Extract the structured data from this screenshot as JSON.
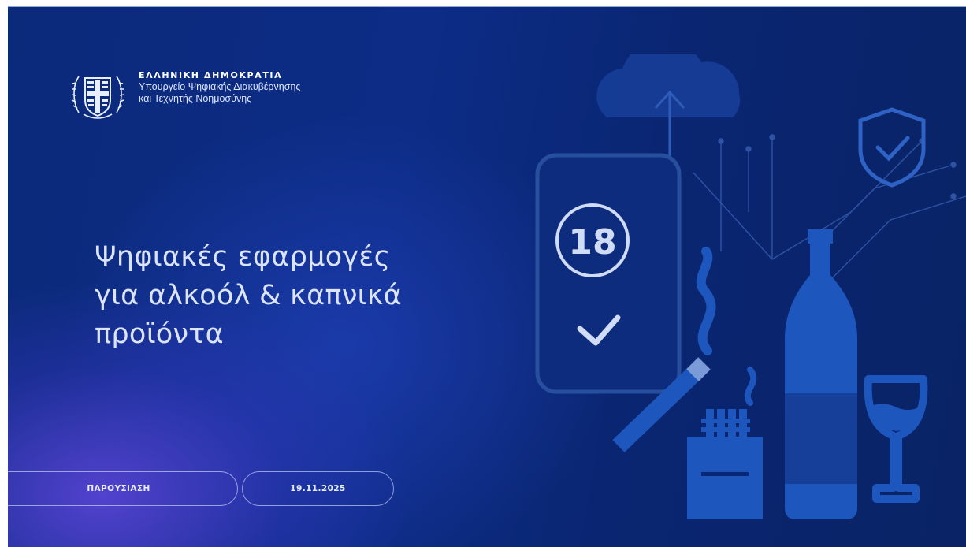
{
  "header": {
    "org_name": "ΕΛΛΗΝΙΚΗ ΔΗΜΟΚΡΑΤΙΑ",
    "org_line1": "Υπουργείο Ψηφιακής Διακυβέρνησης",
    "org_line2": "και Τεχνητής Νοημοσύνης"
  },
  "title": {
    "line1": "Ψηφιακές εφαρμογές",
    "line2": "για αλκοόλ & καπνικά",
    "line3": "προϊόντα"
  },
  "footer": {
    "type_label": "ΠΑΡΟΥΣΙΑΣΗ",
    "date": "19.11.2025"
  },
  "illustration": {
    "age_badge": "18",
    "icons": [
      "cloud-upload-icon",
      "shield-check-icon",
      "phone-check-icon",
      "cigarette-icon",
      "cigarette-pack-icon",
      "wine-bottle-icon",
      "wine-glass-icon"
    ]
  },
  "colors": {
    "background_dark": "#0a2366",
    "background_glow": "#5f46dc",
    "icon_fill": "#1f55b8",
    "outline": "#6f8fd0",
    "text_light": "#dbe4ff"
  }
}
